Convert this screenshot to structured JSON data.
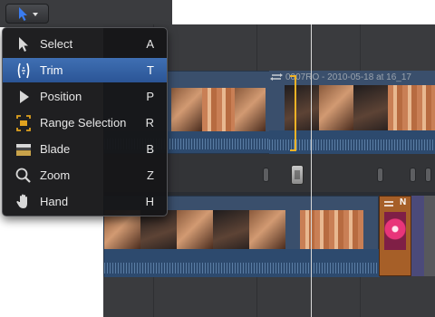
{
  "toolbar": {
    "tool_button_icon": "arrow-select-icon",
    "dropdown_icon": "caret-down-icon",
    "accent": "#2f6fe0"
  },
  "menu": {
    "items": [
      {
        "label": "Select",
        "shortcut": "A",
        "icon": "arrow-icon",
        "selected": false
      },
      {
        "label": "Trim",
        "shortcut": "T",
        "icon": "trim-icon",
        "selected": true
      },
      {
        "label": "Position",
        "shortcut": "P",
        "icon": "position-arrow-icon",
        "selected": false
      },
      {
        "label": "Range Selection",
        "shortcut": "R",
        "icon": "range-selection-icon",
        "selected": false
      },
      {
        "label": "Blade",
        "shortcut": "B",
        "icon": "blade-icon",
        "selected": false
      },
      {
        "label": "Zoom",
        "shortcut": "Z",
        "icon": "magnifier-icon",
        "selected": false
      },
      {
        "label": "Hand",
        "shortcut": "H",
        "icon": "hand-icon",
        "selected": false
      }
    ]
  },
  "timeline": {
    "connected_clip_title": "0007RO - 2010-05-18 at 16_17",
    "orange_clip_label": "N",
    "colors": {
      "clip_blue": "#3a4f6c",
      "trim_highlight": "#f0b226",
      "selection_blue": "#2b5596"
    }
  }
}
